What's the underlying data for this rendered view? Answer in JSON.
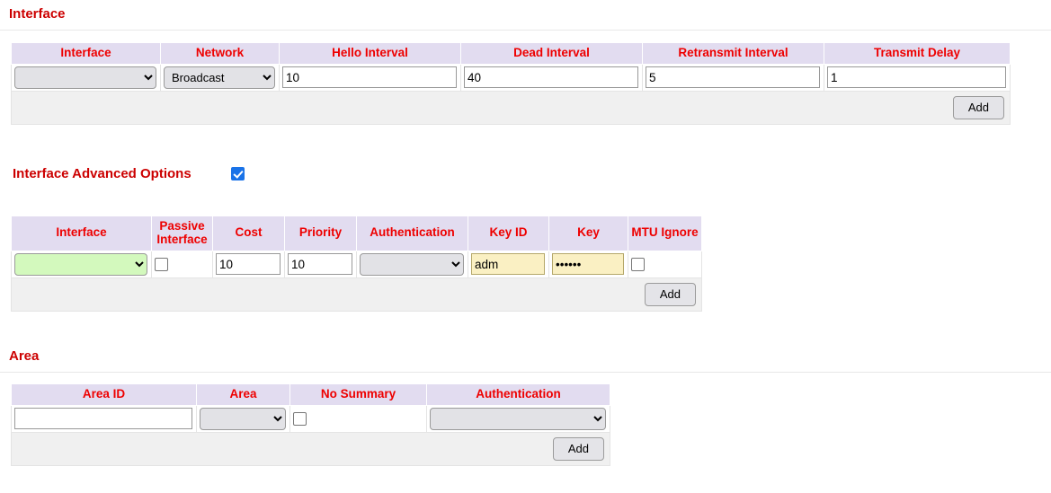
{
  "colors": {
    "heading_red": "#cc0000",
    "header_label_red": "#ee0000",
    "table_header_bg": "#e2dcf0",
    "addrow_bg": "#f0f0f0",
    "select_bg": "#e2e2e6",
    "select_green_bg": "#d3f9bd",
    "autofill_bg": "#faf0c3",
    "checkbox_checked_bg": "#1a73e8"
  },
  "interface_section": {
    "title": "Interface",
    "columns": [
      "Interface",
      "Network",
      "Hello Interval",
      "Dead Interval",
      "Retransmit Interval",
      "Transmit Delay"
    ],
    "row": {
      "interface_value": "",
      "network_value": "Broadcast",
      "hello_interval": "10",
      "dead_interval": "40",
      "retransmit_interval": "5",
      "transmit_delay": "1"
    },
    "add_label": "Add"
  },
  "advanced_section": {
    "title": "Interface Advanced Options",
    "enabled_checkbox": true,
    "columns": [
      "Interface",
      "Passive Interface",
      "Cost",
      "Priority",
      "Authentication",
      "Key ID",
      "Key",
      "MTU Ignore"
    ],
    "row": {
      "interface_value": "",
      "passive_interface_checked": false,
      "cost": "10",
      "priority": "10",
      "authentication_value": "",
      "key_id": "adm",
      "key": "••••••",
      "mtu_ignore_checked": false
    },
    "add_label": "Add"
  },
  "area_section": {
    "title": "Area",
    "columns": [
      "Area ID",
      "Area",
      "No Summary",
      "Authentication"
    ],
    "row": {
      "area_id": "",
      "area_value": "",
      "no_summary_checked": false,
      "authentication_value": ""
    },
    "add_label": "Add"
  }
}
